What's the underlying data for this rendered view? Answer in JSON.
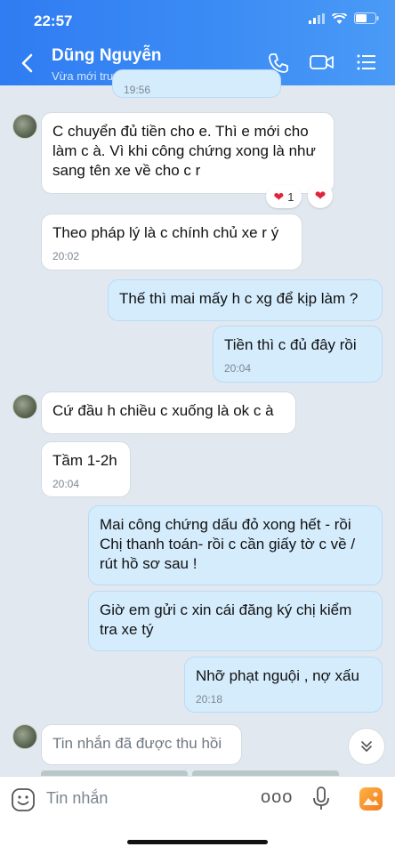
{
  "status_bar": {
    "time": "22:57"
  },
  "header": {
    "contact_name": "Dũng Nguyễn",
    "contact_status": "Vừa mới truy cập"
  },
  "messages": [
    {
      "id": 0,
      "from": "me",
      "text": "",
      "time": "19:56"
    },
    {
      "id": 1,
      "from": "them",
      "text": "C chuyển đủ tiền cho e. Thì e mới cho làm c à. Vì khi công chứng xong là như sang tên xe về cho c r",
      "time": ""
    },
    {
      "id": 2,
      "from": "them",
      "text": "Theo pháp lý là c chính chủ xe r ý",
      "time": "20:02"
    },
    {
      "id": 3,
      "from": "me",
      "text": "Thế thì mai mấy h c xg để kịp làm ?",
      "time": ""
    },
    {
      "id": 4,
      "from": "me",
      "text": "Tiền thì c đủ đây rồi",
      "time": "20:04"
    },
    {
      "id": 5,
      "from": "them",
      "text": "Cứ đầu h chiều c xuống là ok c à",
      "time": ""
    },
    {
      "id": 6,
      "from": "them",
      "text": "Tầm 1-2h",
      "time": "20:04"
    },
    {
      "id": 7,
      "from": "me",
      "text": "Mai công chứng dấu đỏ xong hết - rồi Chị thanh toán-  rồi c cần giấy tờ c về / rút hồ sơ sau !",
      "time": ""
    },
    {
      "id": 8,
      "from": "me",
      "text": "Giờ em gửi c xin cái đăng ký chị kiểm tra xe tý",
      "time": ""
    },
    {
      "id": 9,
      "from": "me",
      "text": "Nhỡ phạt nguội , nợ xấu",
      "time": "20:18"
    },
    {
      "id": 10,
      "from": "them",
      "text": "Tin nhắn đã được thu hồi",
      "time": ""
    }
  ],
  "reactions": {
    "count_label": "1"
  },
  "composer": {
    "placeholder": "Tin nhắn",
    "more_label": "ooo"
  },
  "colors": {
    "header": "#3d8df5",
    "my_bubble": "#d5ecfd",
    "their_bubble": "#ffffff",
    "heart": "#e0243a"
  }
}
